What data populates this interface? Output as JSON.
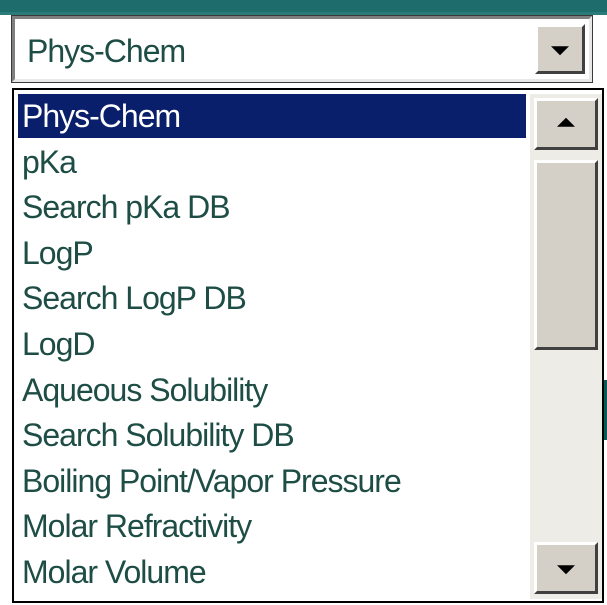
{
  "combo": {
    "selected_value": "Phys-Chem",
    "button_icon": "chevron-down-icon"
  },
  "dropdown": {
    "items": [
      "Phys-Chem",
      "pKa",
      "Search pKa DB",
      "LogP",
      "Search LogP DB",
      "LogD",
      "Aqueous Solubility",
      "Search Solubility DB",
      "Boiling Point/Vapor Pressure",
      "Molar Refractivity",
      "Molar Volume"
    ],
    "selected_index": 0
  },
  "scrollbar": {
    "up_icon": "arrow-up-icon",
    "down_icon": "arrow-down-icon"
  },
  "colors": {
    "text": "#1e4d45",
    "selection_bg": "#0a1f6b",
    "selection_text": "#ffffff",
    "button_face": "#d4d0c8",
    "top_strip": "#1f6c6c"
  }
}
